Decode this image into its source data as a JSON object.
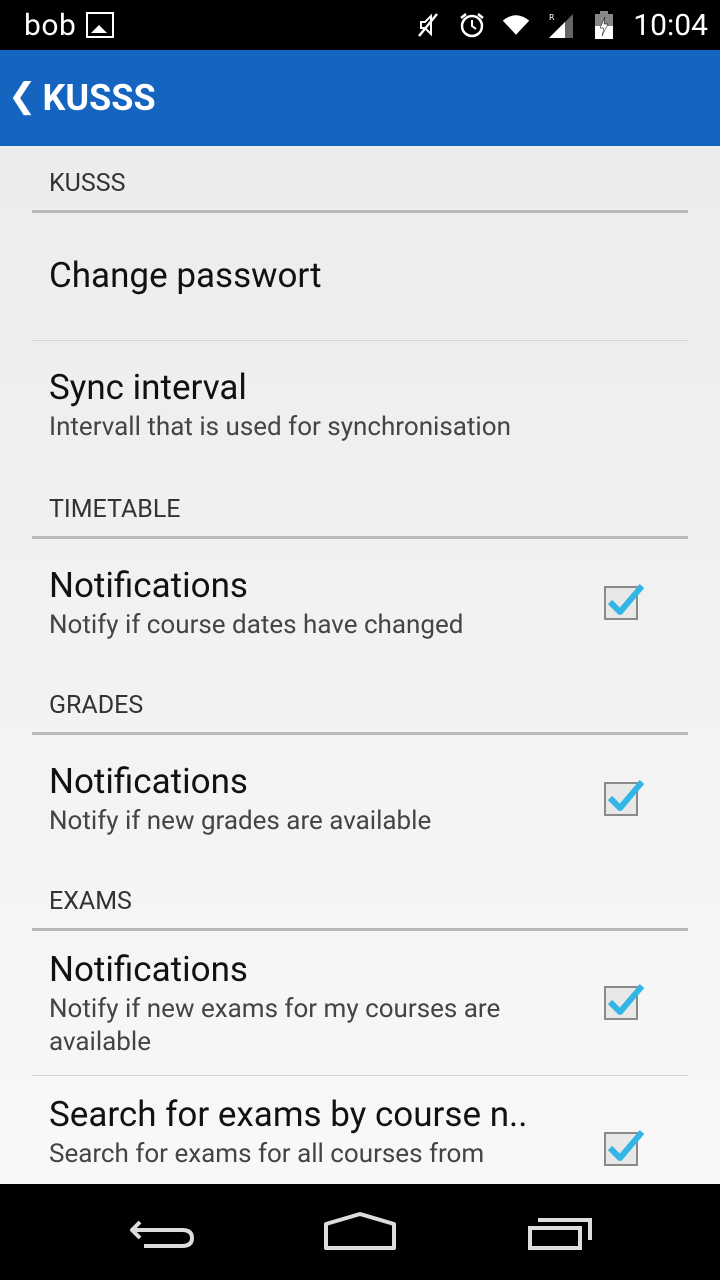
{
  "status_bar": {
    "user": "bob",
    "time": "10:04",
    "icons": [
      "gallery-icon",
      "mute-icon",
      "alarm-icon",
      "wifi-icon",
      "signal-icon",
      "battery-icon"
    ]
  },
  "action_bar": {
    "title": "KUSSS",
    "background": "#1565c0"
  },
  "settings": {
    "kusss_header": "KUSSS",
    "change_password": "Change passwort",
    "sync_title": "Sync interval",
    "sync_summary": "Intervall that is used for synchronisation",
    "timetable_header": "TIMETABLE",
    "timetable_notif_title": "Notifications",
    "timetable_notif_summary": "Notify if course dates have changed",
    "timetable_notif_checked": true,
    "grades_header": "GRADES",
    "grades_notif_title": "Notifications",
    "grades_notif_summary": "Notify if new grades are available",
    "grades_notif_checked": true,
    "exams_header": "EXAMS",
    "exams_notif_title": "Notifications",
    "exams_notif_summary": "Notify if new exams for my courses are available",
    "exams_notif_checked": true,
    "exams_search_title": "Search for exams by course n..",
    "exams_search_summary": "Search for exams for all courses from",
    "exams_search_checked": true
  },
  "accent_color": "#33b5e5",
  "nav_bar": {
    "buttons": [
      "back-icon",
      "home-icon",
      "recents-icon"
    ]
  }
}
